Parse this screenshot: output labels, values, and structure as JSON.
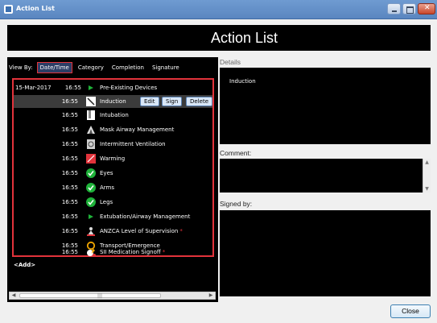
{
  "window": {
    "title": "Action List"
  },
  "header": {
    "title": "Action List"
  },
  "viewby": {
    "label": "View By:",
    "tabs": [
      "Date/Time",
      "Category",
      "Completion",
      "Signature"
    ],
    "active": "Date/Time"
  },
  "actions": [
    {
      "date": "15-Mar-2017",
      "time": "16:55",
      "icon": "flag-icon",
      "label": "Pre-Existing Devices",
      "required": false
    },
    {
      "date": "",
      "time": "16:55",
      "icon": "syringe-icon",
      "label": "Induction",
      "required": false
    },
    {
      "date": "",
      "time": "16:55",
      "icon": "tube-icon",
      "label": "Intubation",
      "required": false
    },
    {
      "date": "",
      "time": "16:55",
      "icon": "airway-mask-icon",
      "label": "Mask Airway Management",
      "required": false
    },
    {
      "date": "",
      "time": "16:55",
      "icon": "ventilator-icon",
      "label": "Intermittent Ventilation",
      "required": false
    },
    {
      "date": "",
      "time": "16:55",
      "icon": "warming-icon",
      "label": "Warming",
      "required": false
    },
    {
      "date": "",
      "time": "16:55",
      "icon": "check-circle-icon",
      "label": "Eyes",
      "required": false
    },
    {
      "date": "",
      "time": "16:55",
      "icon": "check-circle-icon",
      "label": "Arms",
      "required": false
    },
    {
      "date": "",
      "time": "16:55",
      "icon": "check-circle-icon",
      "label": "Legs",
      "required": false
    },
    {
      "date": "",
      "time": "16:55",
      "icon": "flag-icon",
      "label": "Extubation/Airway Management",
      "required": false
    },
    {
      "date": "",
      "time": "16:55",
      "icon": "supervisor-icon",
      "label": "ANZCA Level of Supervision",
      "required": true
    },
    {
      "date": "",
      "time": "16:55",
      "icon": "ring-icon",
      "label": "Transport/Emergence",
      "required": false
    },
    {
      "date": "",
      "time": "16:55",
      "icon": "medication-icon",
      "label": "SII Medication Signoff",
      "required": true
    }
  ],
  "selected_row": {
    "edit_label": "Edit",
    "sign_label": "Sign",
    "delete_label": "Delete"
  },
  "add_label": "<Add>",
  "details": {
    "label": "Details",
    "text": "Induction"
  },
  "comment": {
    "label": "Comment:"
  },
  "signed_by": {
    "label": "Signed by:"
  },
  "footer": {
    "close_label": "Close"
  },
  "colors": {
    "highlight_border": "#e2333b",
    "panel_bg": "#000000",
    "check_green": "#1fb33a"
  }
}
